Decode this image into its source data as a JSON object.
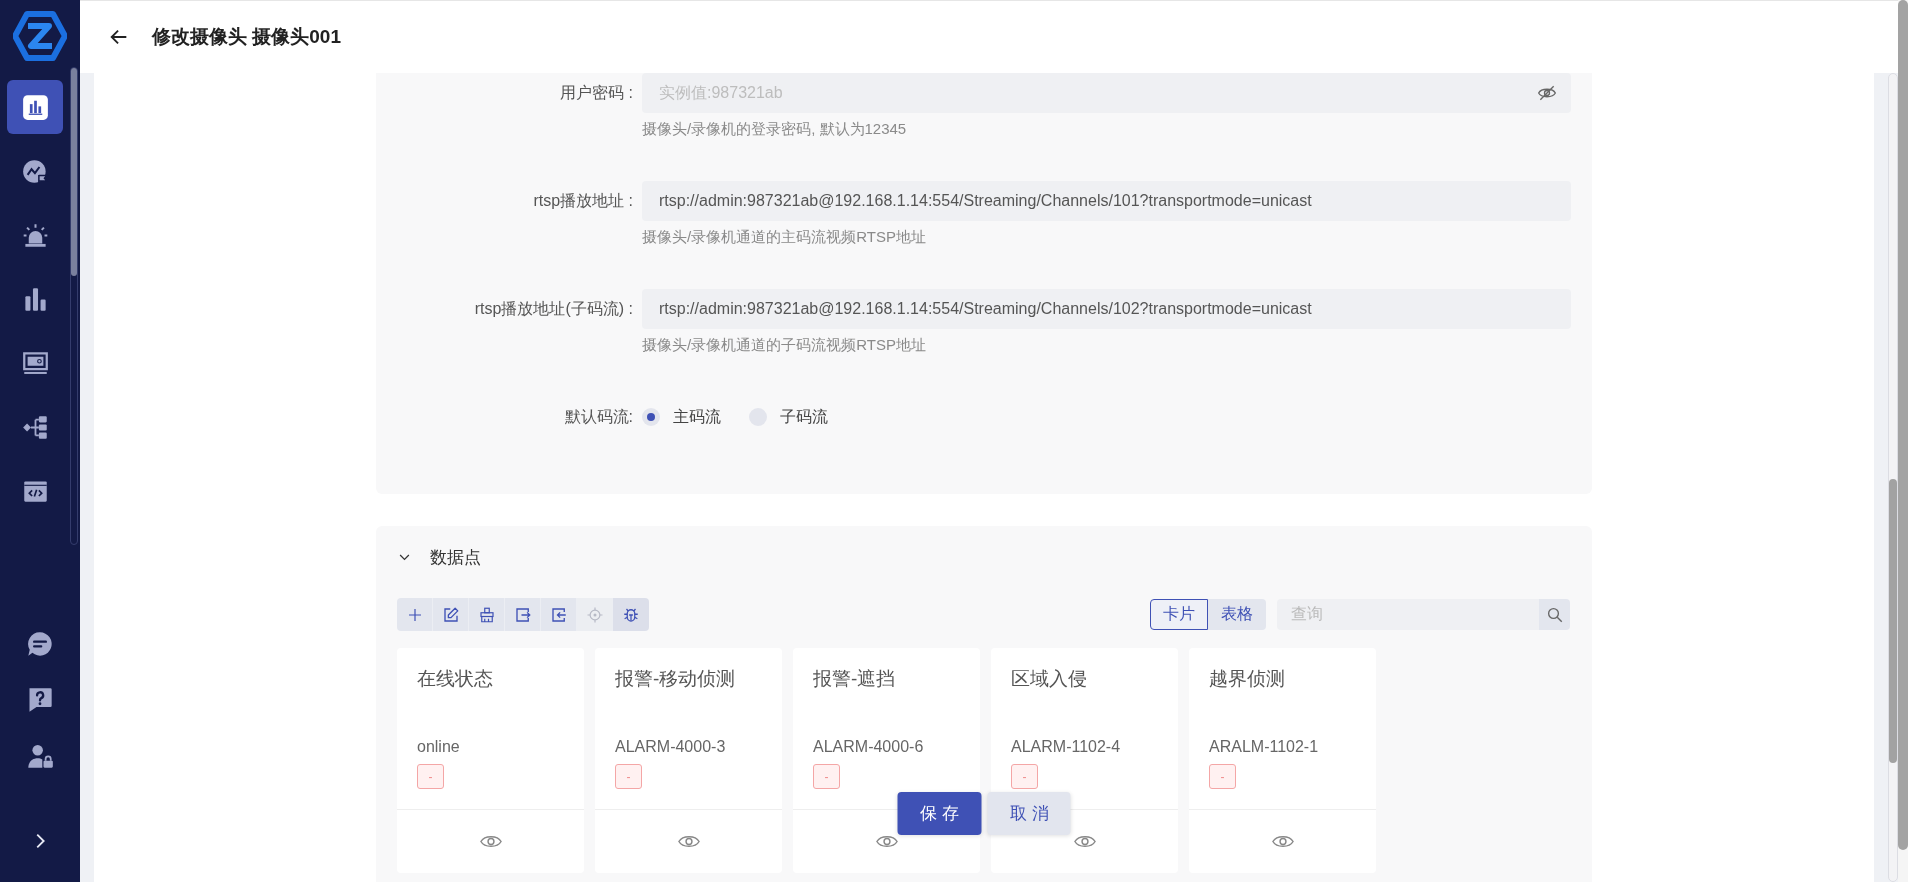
{
  "sidebar": {
    "nav_items": [
      {
        "selected": true
      },
      {
        "selected": false
      },
      {
        "selected": false
      },
      {
        "selected": false
      },
      {
        "selected": false
      },
      {
        "selected": false
      },
      {
        "selected": false
      }
    ]
  },
  "header": {
    "title": "修改摄像头 摄像头001"
  },
  "form": {
    "fields": [
      {
        "kind": "password",
        "label": "用户密码 :",
        "placeholder": "实例值:987321ab",
        "hint": "摄像头/录像机的登录密码, 默认为12345"
      },
      {
        "kind": "text",
        "label": "rtsp播放地址 :",
        "value": "rtsp://admin:987321ab@192.168.1.14:554/Streaming/Channels/101?transportmode=unicast",
        "hint": "摄像头/录像机通道的主码流视频RTSP地址"
      },
      {
        "kind": "text",
        "label": "rtsp播放地址(子码流) :",
        "value": "rtsp://admin:987321ab@192.168.1.14:554/Streaming/Channels/102?transportmode=unicast",
        "hint": "摄像头/录像机通道的子码流视频RTSP地址"
      },
      {
        "kind": "radio",
        "label": "默认码流:",
        "options": [
          {
            "label": "主码流",
            "selected": true
          },
          {
            "label": "子码流",
            "selected": false
          }
        ]
      }
    ]
  },
  "data_points": {
    "title": "数据点",
    "expanded": true,
    "toolbar": [
      {
        "disabled": false
      },
      {
        "disabled": false
      },
      {
        "disabled": false
      },
      {
        "disabled": false
      },
      {
        "disabled": false
      },
      {
        "disabled": true
      },
      {
        "disabled": false
      }
    ],
    "view_tabs": [
      {
        "label": "卡片",
        "selected": true
      },
      {
        "label": "表格",
        "selected": false
      }
    ],
    "search": {
      "placeholder": "查询"
    },
    "cards": [
      {
        "name": "在线状态",
        "code": "online",
        "tag": "-"
      },
      {
        "name": "报警-移动侦测",
        "code": "ALARM-4000-3",
        "tag": "-"
      },
      {
        "name": "报警-遮挡",
        "code": "ALARM-4000-6",
        "tag": "-"
      },
      {
        "name": "区域入侵",
        "code": "ALARM-1102-4",
        "tag": "-"
      },
      {
        "name": "越界侦测",
        "code": "ARALM-1102-1",
        "tag": "-"
      }
    ]
  },
  "actions": [
    {
      "kind": "primary",
      "label": "保存"
    },
    {
      "kind": "secondary",
      "label": "取消"
    }
  ]
}
